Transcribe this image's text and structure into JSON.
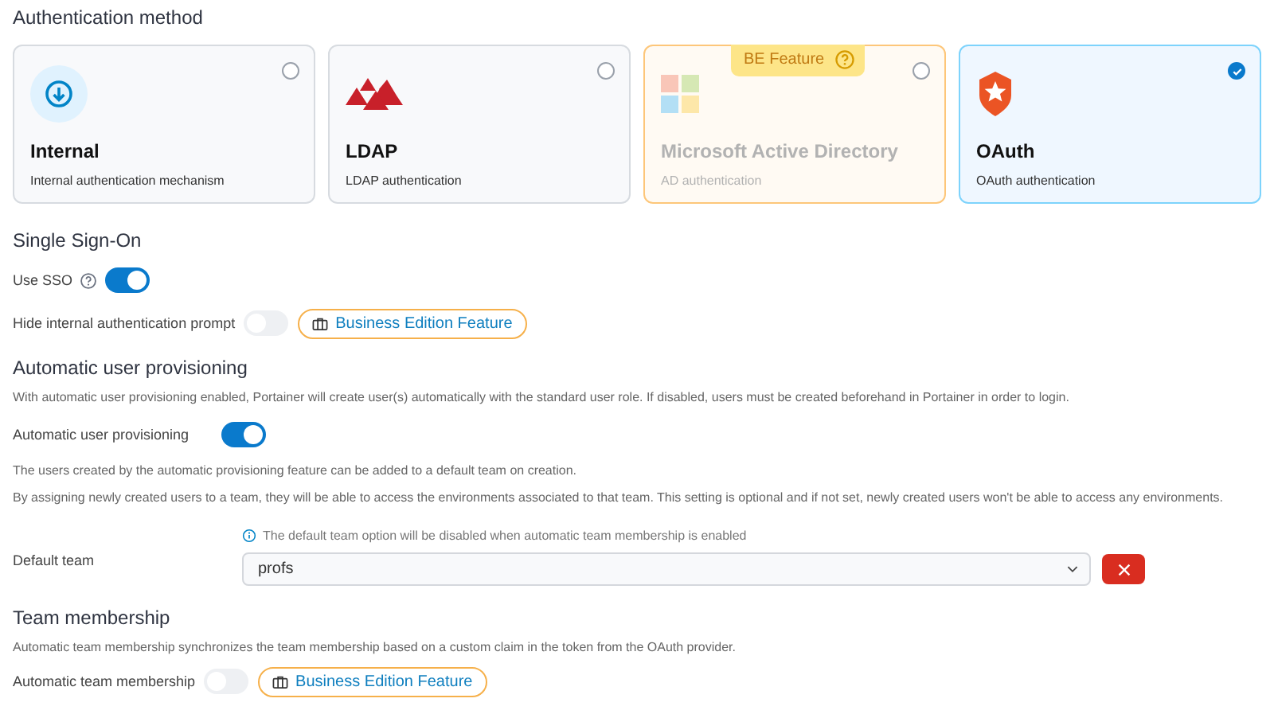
{
  "auth_method": {
    "title": "Authentication method",
    "options": [
      {
        "kind": "internal",
        "title": "Internal",
        "description": "Internal authentication mechanism",
        "selected": false,
        "disabled": false
      },
      {
        "kind": "ldap",
        "title": "LDAP",
        "description": "LDAP authentication",
        "selected": false,
        "disabled": false
      },
      {
        "kind": "ad",
        "title": "Microsoft Active Directory",
        "description": "AD authentication",
        "selected": false,
        "disabled": true,
        "badge": "BE Feature"
      },
      {
        "kind": "oauth",
        "title": "OAuth",
        "description": "OAuth authentication",
        "selected": true,
        "disabled": false
      }
    ]
  },
  "sso": {
    "title": "Single Sign-On",
    "toggles": [
      {
        "label": "Use SSO",
        "on": true,
        "help": true
      },
      {
        "label": "Hide internal authentication prompt",
        "on": false,
        "help": false,
        "badge": "Business Edition Feature"
      }
    ]
  },
  "provisioning": {
    "title": "Automatic user provisioning",
    "description": "With automatic user provisioning enabled, Portainer will create user(s) automatically with the standard user role. If disabled, users must be created beforehand in Portainer in order to login.",
    "toggle": {
      "label": "Automatic user provisioning",
      "on": true
    },
    "notes": [
      "The users created by the automatic provisioning feature can be added to a default team on creation.",
      "By assigning newly created users to a team, they will be able to access the environments associated to that team. This setting is optional and if not set, newly created users won't be able to access any environments."
    ],
    "default_team": {
      "label": "Default team",
      "hint": "The default team option will be disabled when automatic team membership is enabled",
      "value": "profs"
    }
  },
  "team_membership": {
    "title": "Team membership",
    "description": "Automatic team membership synchronizes the team membership based on a custom claim in the token from the OAuth provider.",
    "toggle": {
      "label": "Automatic team membership",
      "on": false,
      "badge": "Business Edition Feature"
    }
  }
}
